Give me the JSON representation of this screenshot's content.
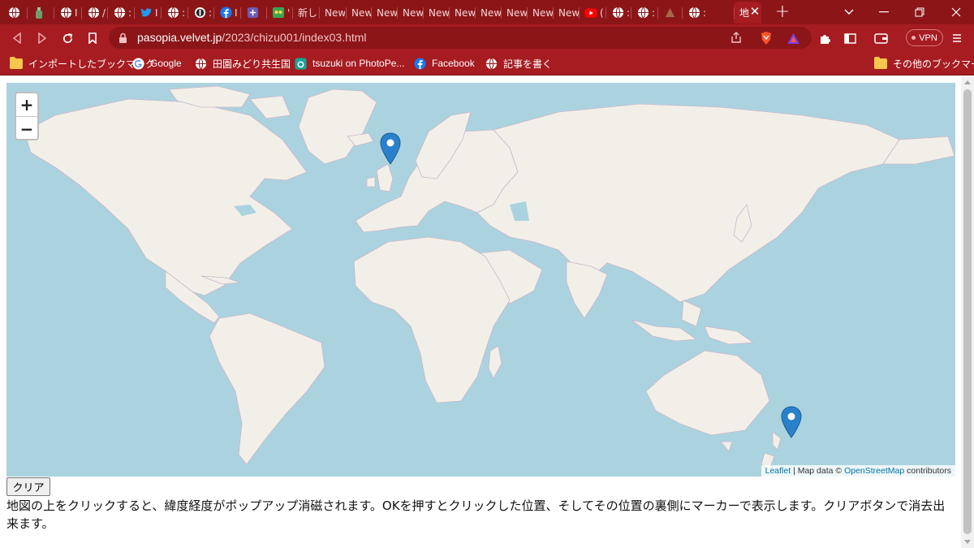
{
  "browser": {
    "tabs": [
      {
        "icon": "globe-icon",
        "title": ""
      },
      {
        "icon": "bottle-icon",
        "title": ""
      },
      {
        "icon": "globe-icon",
        "title": "I"
      },
      {
        "icon": "globe-icon",
        "title": "/"
      },
      {
        "icon": "globe-icon",
        "title": ":"
      },
      {
        "icon": "twitter-icon",
        "title": "I"
      },
      {
        "icon": "globe-icon",
        "title": ":"
      },
      {
        "icon": "onepassword-icon",
        "title": ":"
      },
      {
        "icon": "facebook-icon",
        "title": "I"
      },
      {
        "icon": "purple-app-icon",
        "title": ""
      },
      {
        "icon": "green-app-icon",
        "title": "'"
      },
      {
        "icon": "",
        "title": "新しい"
      },
      {
        "icon": "",
        "title": "New"
      },
      {
        "icon": "",
        "title": "New"
      },
      {
        "icon": "",
        "title": "New"
      },
      {
        "icon": "",
        "title": "New"
      },
      {
        "icon": "",
        "title": "New"
      },
      {
        "icon": "",
        "title": "New"
      },
      {
        "icon": "",
        "title": "New"
      },
      {
        "icon": "",
        "title": "New"
      },
      {
        "icon": "",
        "title": "New"
      },
      {
        "icon": "",
        "title": "New"
      },
      {
        "icon": "youtube-icon",
        "title": "("
      },
      {
        "icon": "globe-icon",
        "title": ":"
      },
      {
        "icon": "globe-icon",
        "title": ":"
      },
      {
        "icon": "brown-app-icon",
        "title": ""
      },
      {
        "icon": "globe-icon",
        "title": ":"
      },
      {
        "icon": "",
        "title": "地"
      }
    ],
    "new_tab": "+",
    "url_host": "pasopia.velvet.jp",
    "url_path": "/2023/chizu001/index03.html",
    "vpn_label": "VPN",
    "bookmarks": [
      {
        "icon": "folder-icon",
        "label": "インポートしたブックマーク"
      },
      {
        "icon": "google-icon",
        "label": "Google"
      },
      {
        "icon": "globe-icon",
        "label": "田園みどり共生国"
      },
      {
        "icon": "photopea-icon",
        "label": "tsuzuki on PhotoPe..."
      },
      {
        "icon": "facebook-icon",
        "label": "Facebook"
      },
      {
        "icon": "globe-icon",
        "label": "記事を書く"
      }
    ],
    "other_bookmarks": "その他のブックマーク",
    "accent_color": "#a61c20",
    "tabstrip_color": "#8c1518"
  },
  "map": {
    "zoom_in": "+",
    "zoom_out": "−",
    "attribution": {
      "leaflet": "Leaflet",
      "sep": " | Map data © ",
      "osm": "OpenStreetMap",
      "contributors": " contributors"
    },
    "markers": [
      {
        "name": "marker-uk",
        "place": "England"
      },
      {
        "name": "marker-nz",
        "place": "New Zealand"
      }
    ],
    "water_color": "#aad3df",
    "land_color": "#f2efe9"
  },
  "page": {
    "clear_button": "クリア",
    "description": "地図の上をクリックすると、緯度経度がポップアップ消磁されます。OKを押すとクリックした位置、そしてその位置の裏側にマーカーで表示します。クリアボタンで消去出来ます。"
  }
}
